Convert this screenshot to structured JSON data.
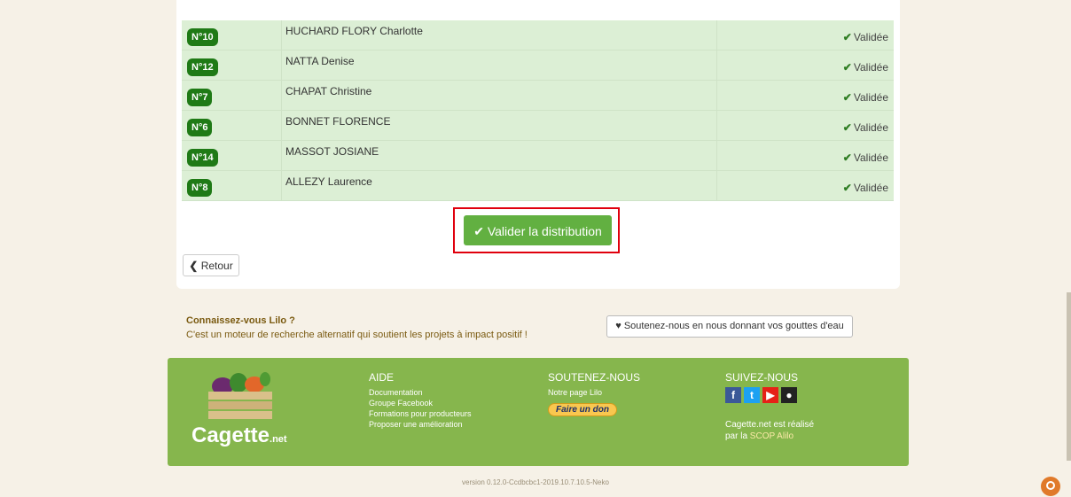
{
  "table": {
    "rows": [
      {
        "badge": "N°10",
        "name": "HUCHARD FLORY Charlotte",
        "status": "Validée"
      },
      {
        "badge": "N°12",
        "name": "NATTA Denise",
        "status": "Validée"
      },
      {
        "badge": "N°7",
        "name": "CHAPAT Christine",
        "status": "Validée"
      },
      {
        "badge": "N°6",
        "name": "BONNET FLORENCE",
        "status": "Validée"
      },
      {
        "badge": "N°14",
        "name": "MASSOT JOSIANE",
        "status": "Validée"
      },
      {
        "badge": "N°8",
        "name": "ALLEZY Laurence",
        "status": "Validée"
      }
    ],
    "status_icon": "check-icon"
  },
  "actions": {
    "validate_label": "Valider la distribution",
    "back_label": "Retour"
  },
  "lilo": {
    "title": "Connaissez-vous Lilo ?",
    "text": "C'est un moteur de recherche alternatif qui soutient les projets à impact positif !",
    "support_label": "Soutenez-nous en nous donnant vos gouttes d'eau"
  },
  "footer": {
    "logo_text": "Cagette",
    "logo_suffix": ".net",
    "aide": {
      "title": "AIDE",
      "links": [
        "Documentation",
        "Groupe Facebook",
        "Formations pour producteurs",
        "Proposer une amélioration"
      ]
    },
    "soutenez": {
      "title": "SOUTENEZ-NOUS",
      "link": "Notre page Lilo",
      "don_label": "Faire un don"
    },
    "suivez": {
      "title": "SUIVEZ-NOUS",
      "credit_line1": "Cagette.net est réalisé",
      "credit_prefix": "par la",
      "credit_link": "SCOP Alilo"
    }
  },
  "version": "version 0.12.0-Ccdbcbc1-2019.10.7.10.5-Neko",
  "colors": {
    "badge": "#1f7a16",
    "row_bg": "#dcefd5",
    "validate_button": "#62b041",
    "highlight_border": "#e0000d",
    "footer": "#86b64d"
  }
}
